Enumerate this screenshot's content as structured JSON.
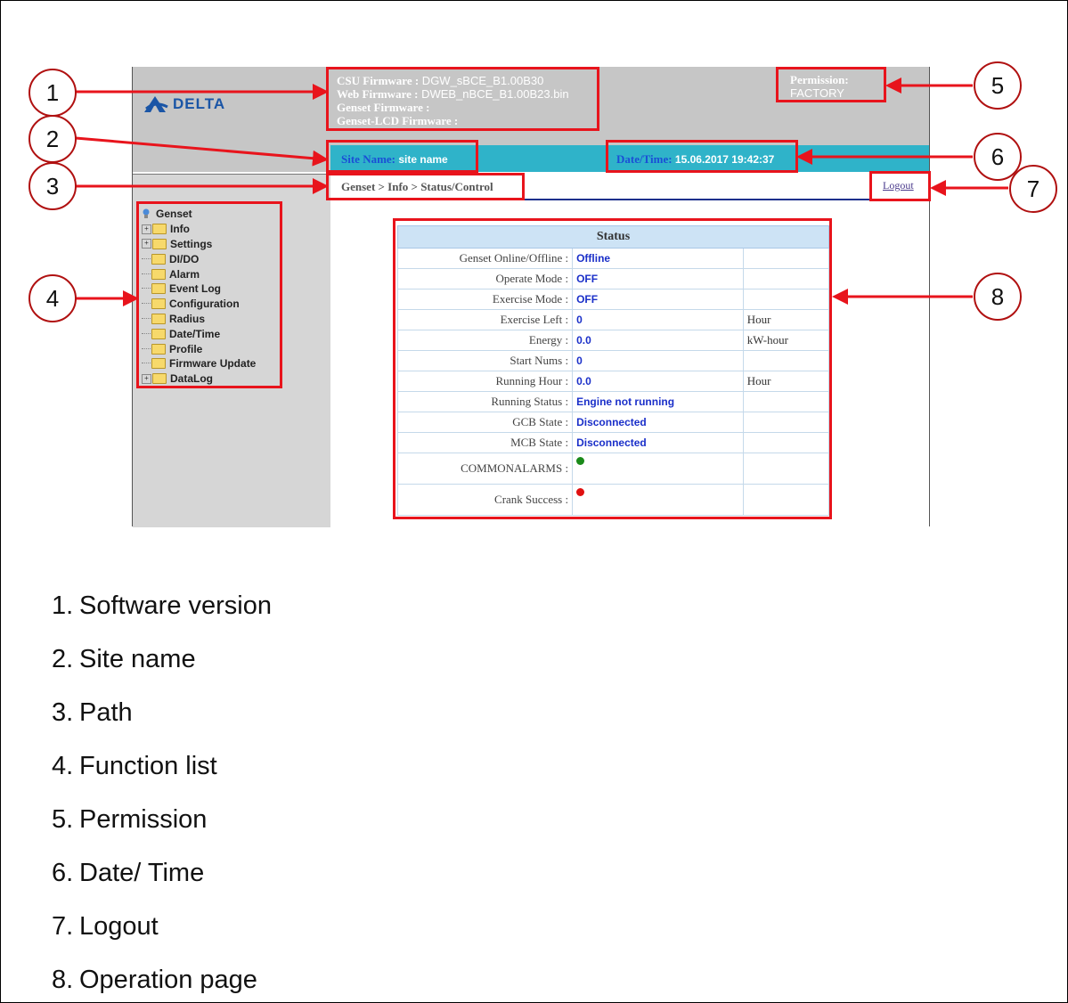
{
  "header": {
    "logo_text": "DELTA",
    "firmware": [
      {
        "label": "CSU Firmware :",
        "value": " DGW_sBCE_B1.00B30"
      },
      {
        "label": "Web Firmware :",
        "value": " DWEB_nBCE_B1.00B23.bin"
      },
      {
        "label": "Genset Firmware :",
        "value": ""
      },
      {
        "label": "Genset-LCD Firmware :",
        "value": ""
      }
    ],
    "permission_label": "Permission:",
    "permission_value": "FACTORY"
  },
  "info_bar": {
    "site_label": "Site Name:",
    "site_value": " site name",
    "datetime_label": "Date/Time:",
    "datetime_value": " 15.06.2017 19:42:37"
  },
  "breadcrumb": "Genset > Info > Status/Control",
  "logout_label": "Logout",
  "tree": {
    "root": "Genset",
    "items": [
      "Info",
      "Settings",
      "DI/DO",
      "Alarm",
      "Event Log",
      "Configuration",
      "Radius",
      "Date/Time",
      "Profile",
      "Firmware Update",
      "DataLog"
    ],
    "expandable": [
      "Info",
      "Settings",
      "DataLog"
    ]
  },
  "status": {
    "title": "Status",
    "rows": [
      {
        "label": "Genset Online/Offline :",
        "value": "Offline",
        "unit": ""
      },
      {
        "label": "Operate Mode :",
        "value": "OFF",
        "unit": ""
      },
      {
        "label": "Exercise Mode :",
        "value": "OFF",
        "unit": ""
      },
      {
        "label": "Exercise Left :",
        "value": "0",
        "unit": "Hour"
      },
      {
        "label": "Energy :",
        "value": "0.0",
        "unit": "kW-hour"
      },
      {
        "label": "Start Nums :",
        "value": "0",
        "unit": ""
      },
      {
        "label": "Running Hour :",
        "value": "0.0",
        "unit": "Hour"
      },
      {
        "label": "Running Status :",
        "value": "Engine not running",
        "unit": ""
      },
      {
        "label": "GCB State :",
        "value": "Disconnected",
        "unit": ""
      },
      {
        "label": "MCB State :",
        "value": "Disconnected",
        "unit": ""
      }
    ],
    "indicators": [
      {
        "label": "COMMONALARMS :",
        "color": "#1a8a1a"
      },
      {
        "label": "Crank Success :",
        "color": "#e01010"
      }
    ]
  },
  "callouts": [
    "1",
    "2",
    "3",
    "4",
    "5",
    "6",
    "7",
    "8"
  ],
  "legend": [
    {
      "num": "1.",
      "text": "Software version"
    },
    {
      "num": "2.",
      "text": "Site name"
    },
    {
      "num": "3.",
      "text": "Path"
    },
    {
      "num": "4.",
      "text": "Function list"
    },
    {
      "num": "5.",
      "text": "Permission"
    },
    {
      "num": "6.",
      "text": "Date/ Time"
    },
    {
      "num": "7.",
      "text": "Logout"
    },
    {
      "num": "8.",
      "text": "Operation page"
    }
  ],
  "colors": {
    "annotation": "#e8141c",
    "teal_bar": "#2fb3c9",
    "value_blue": "#1a2fc9"
  }
}
